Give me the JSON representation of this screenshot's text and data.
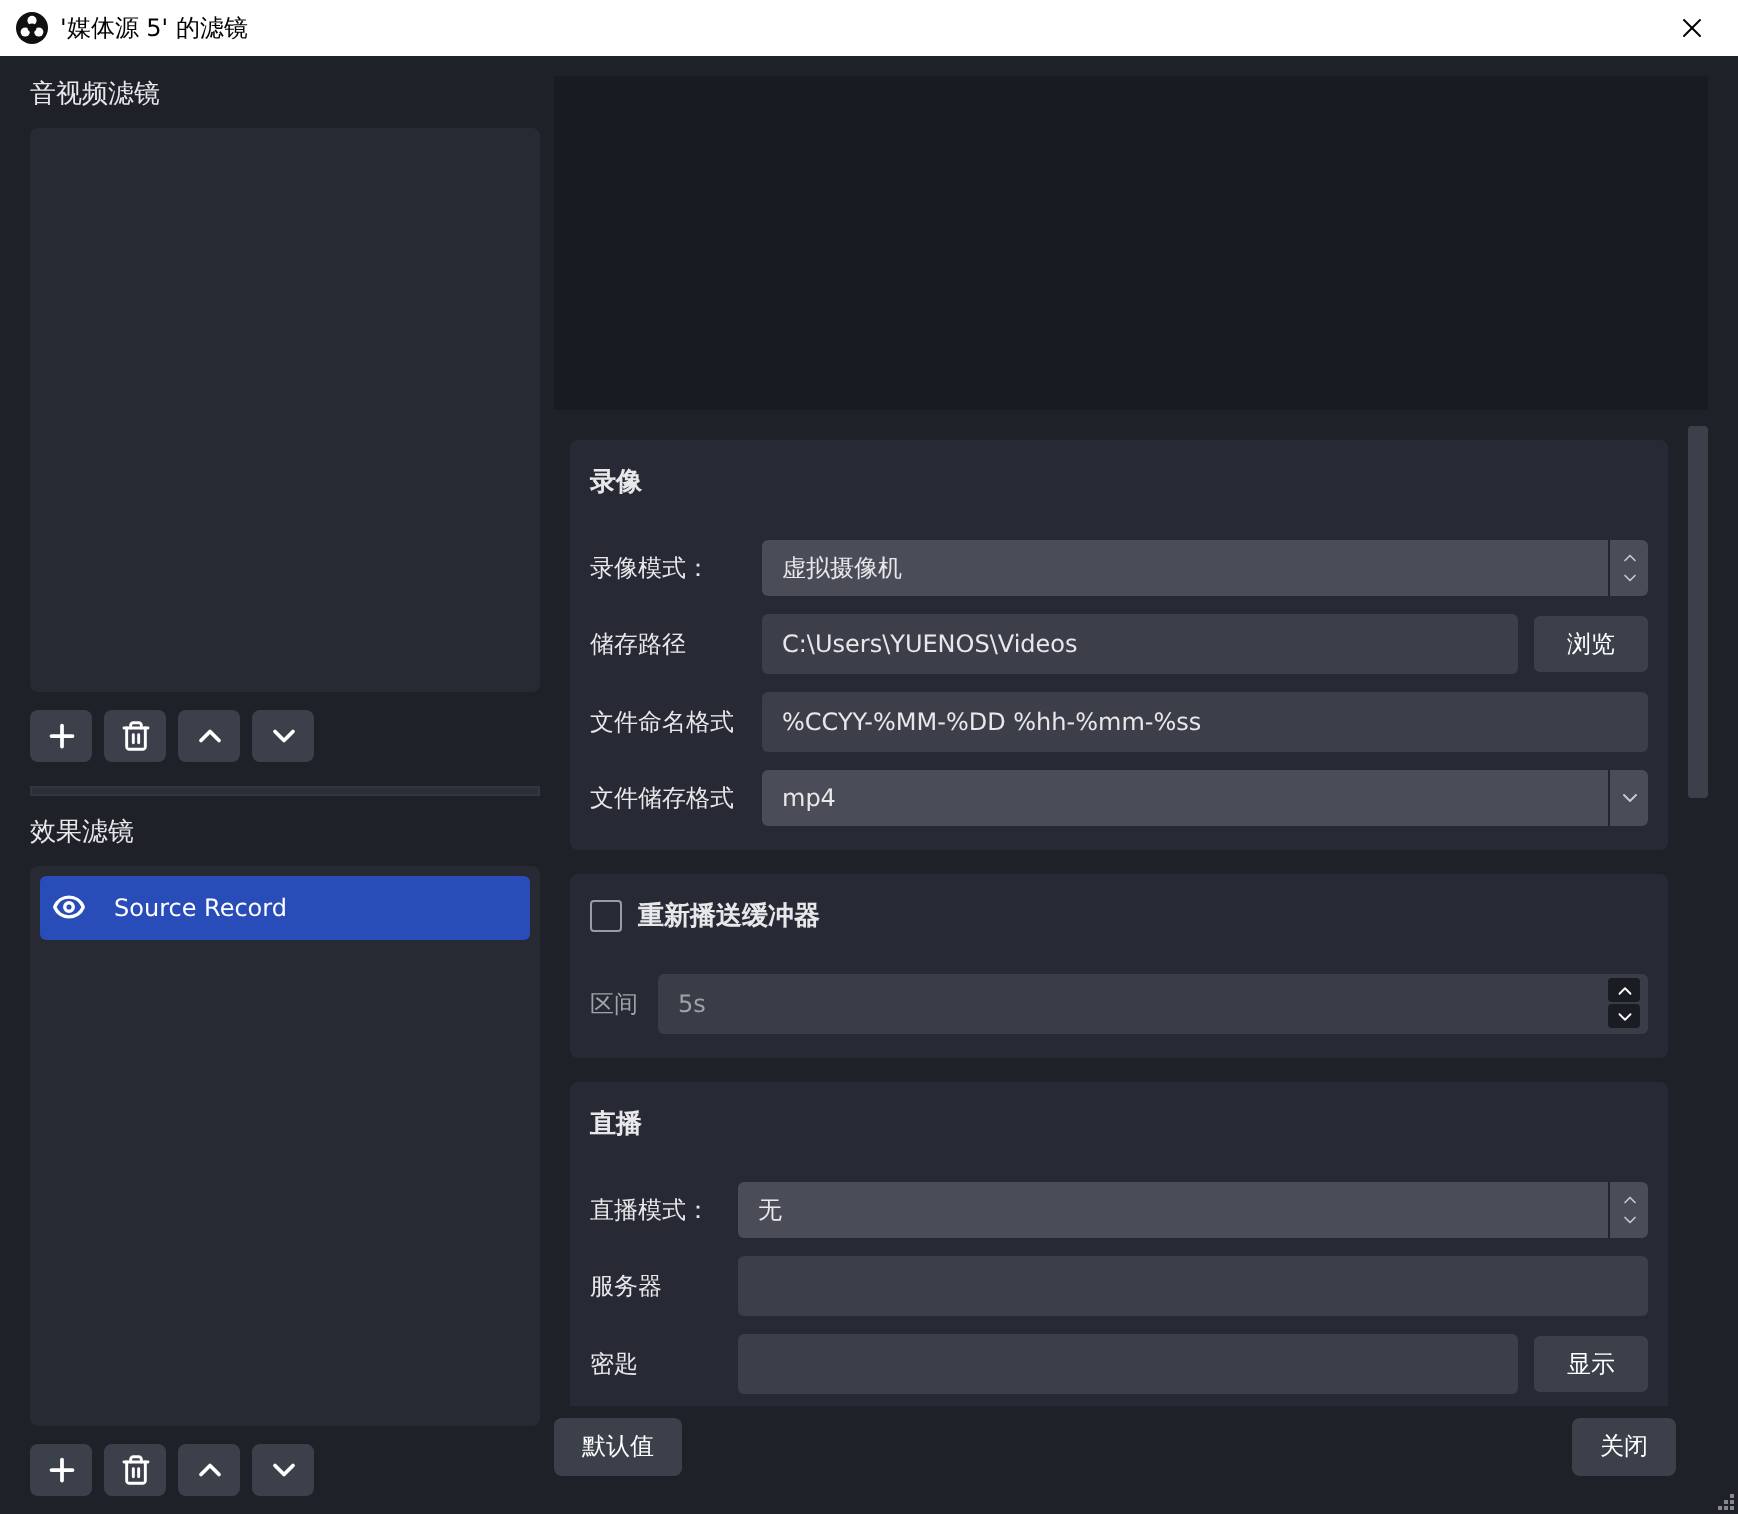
{
  "window": {
    "title": "'媒体源 5' 的滤镜"
  },
  "audio_video_filters": {
    "title": "音视频滤镜"
  },
  "effect_filters": {
    "title": "效果滤镜",
    "items": [
      {
        "name": "Source Record",
        "visible": true,
        "selected": true
      }
    ]
  },
  "sections": [
    {
      "title": "录像",
      "rows": [
        {
          "kind": "combo",
          "label": "录像模式：",
          "value": "虚拟摄像机"
        },
        {
          "kind": "path",
          "label": "储存路径",
          "value": "C:\\Users\\YUENOS\\Videos",
          "button": "浏览"
        },
        {
          "kind": "text",
          "label": "文件命名格式",
          "value": "%CCYY-%MM-%DD %hh-%mm-%ss"
        },
        {
          "kind": "dropdown",
          "label": "文件储存格式",
          "value": "mp4"
        }
      ]
    },
    {
      "title": "重新播送缓冲器",
      "checkbox": {
        "checked": false
      },
      "rows": [
        {
          "kind": "spin",
          "label": "区间",
          "value": "5s",
          "disabled": true
        }
      ]
    },
    {
      "title": "直播",
      "rows": [
        {
          "kind": "combo",
          "label": "直播模式：",
          "value": "无"
        },
        {
          "kind": "text",
          "label": "服务器"
        },
        {
          "kind": "path",
          "label": "密匙",
          "button": "显示"
        }
      ]
    }
  ],
  "footer": {
    "defaults": "默认值",
    "close": "关闭"
  }
}
